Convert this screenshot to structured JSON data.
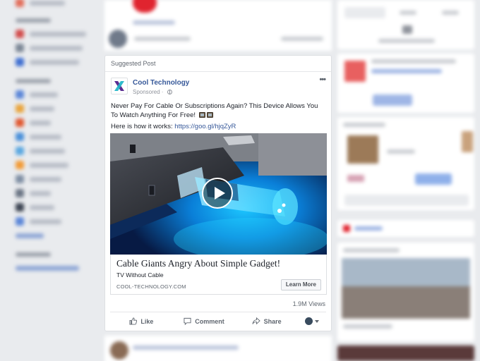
{
  "post": {
    "header": "Suggested Post",
    "author": "Cool Technology",
    "sponsored": "Sponsored",
    "more_icon": "ellipsis-icon",
    "text_line1": "Never Pay For Cable Or Subscriptions Again? This Device Allows You To Watch Anything For Free!",
    "text_line2_prefix": "Here is how it works: ",
    "text_line2_link": "https://goo.gl/hjqZyR",
    "ad_headline": "Cable Giants Angry About Simple Gadget!",
    "ad_description": "TV Without Cable",
    "ad_domain": "COOL-TECHNOLOGY.COM",
    "cta_label": "Learn More",
    "views": "1.9M Views",
    "actions": {
      "like": "Like",
      "comment": "Comment",
      "share": "Share"
    }
  },
  "colors": {
    "page_bg": "#e9ebee",
    "link_blue": "#365899",
    "logo_purple": "#5b2c91",
    "logo_teal": "#1fb5c8",
    "usb_glow": "#14c8ff"
  }
}
